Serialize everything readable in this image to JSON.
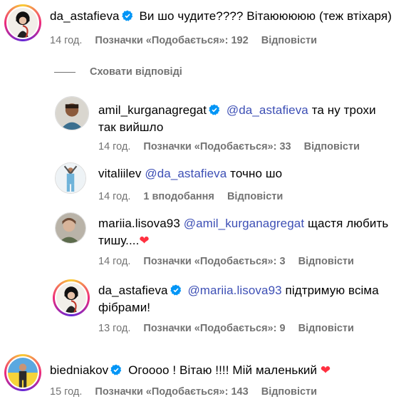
{
  "comments": [
    {
      "user": "da_astafieva",
      "mention": "",
      "text": "Ви шо чудите???? Вітаююююю (теж втіхаря)",
      "time": "14 год.",
      "likes": "Позначки «Подобається»: 192",
      "reply": "Відповісти"
    }
  ],
  "hide_replies": "Сховати відповіді",
  "replies": [
    {
      "user": "amil_kurganagregat",
      "mention": "@da_astafieva",
      "text_line1": "та ну трохи",
      "text_line2": "так вийшло",
      "time": "14 год.",
      "likes": "Позначки «Подобається»: 33",
      "reply": "Відповісти"
    },
    {
      "user": "vitaliilev",
      "mention": "@da_astafieva",
      "text": "точно шо",
      "time": "14 год.",
      "likes": "1 вподобання",
      "reply": "Відповісти"
    },
    {
      "user": "mariia.lisova93",
      "mention": "@amil_kurganagregat",
      "text_line1": "щастя любить",
      "text_line2": "тишу....",
      "emoji": "❤",
      "time": "14 год.",
      "likes": "Позначки «Подобається»: 3",
      "reply": "Відповісти"
    },
    {
      "user": "da_astafieva",
      "mention": "@mariia.lisova93",
      "text_line1": "підтримую всіма",
      "text_line2": "фібрами!",
      "time": "13 год.",
      "likes": "Позначки «Подобається»: 9",
      "reply": "Відповісти"
    }
  ],
  "last": {
    "user": "biedniakov",
    "text": "Огоооо ! Вітаю !!!! Мій маленький",
    "emoji": "❤",
    "time": "15 год.",
    "likes": "Позначки «Подобається»: 143",
    "reply": "Відповісти"
  },
  "colors": {
    "mention": "#3d4fb5",
    "meta": "#737373",
    "verified": "#0095f6",
    "heart": "#ff3040"
  }
}
